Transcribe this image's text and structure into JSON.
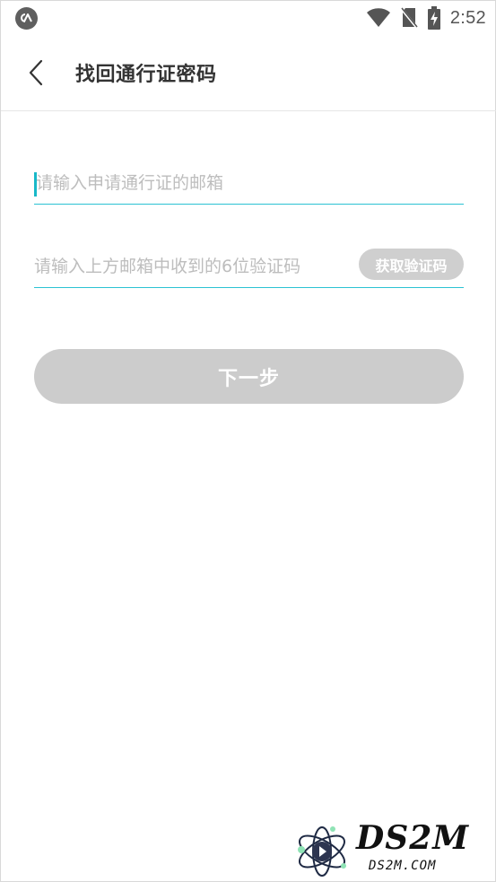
{
  "status_bar": {
    "time": "2:52",
    "icons": [
      "app-notification-icon",
      "wifi-icon",
      "no-sim-icon",
      "battery-charging-icon"
    ]
  },
  "nav": {
    "back_icon": "chevron-left-icon",
    "title": "找回通行证密码"
  },
  "form": {
    "email_placeholder": "请输入申请通行证的邮箱",
    "email_value": "",
    "code_placeholder": "请输入上方邮箱中收到的6位验证码",
    "code_value": "",
    "get_code_label": "获取验证码",
    "next_label": "下一步"
  },
  "colors": {
    "accent": "#2bc2d3",
    "disabled_button": "#cccccc",
    "placeholder": "#bdbdbd",
    "title": "#333333"
  },
  "watermark": {
    "brand": "DS2M",
    "domain": "DS2M.COM"
  }
}
